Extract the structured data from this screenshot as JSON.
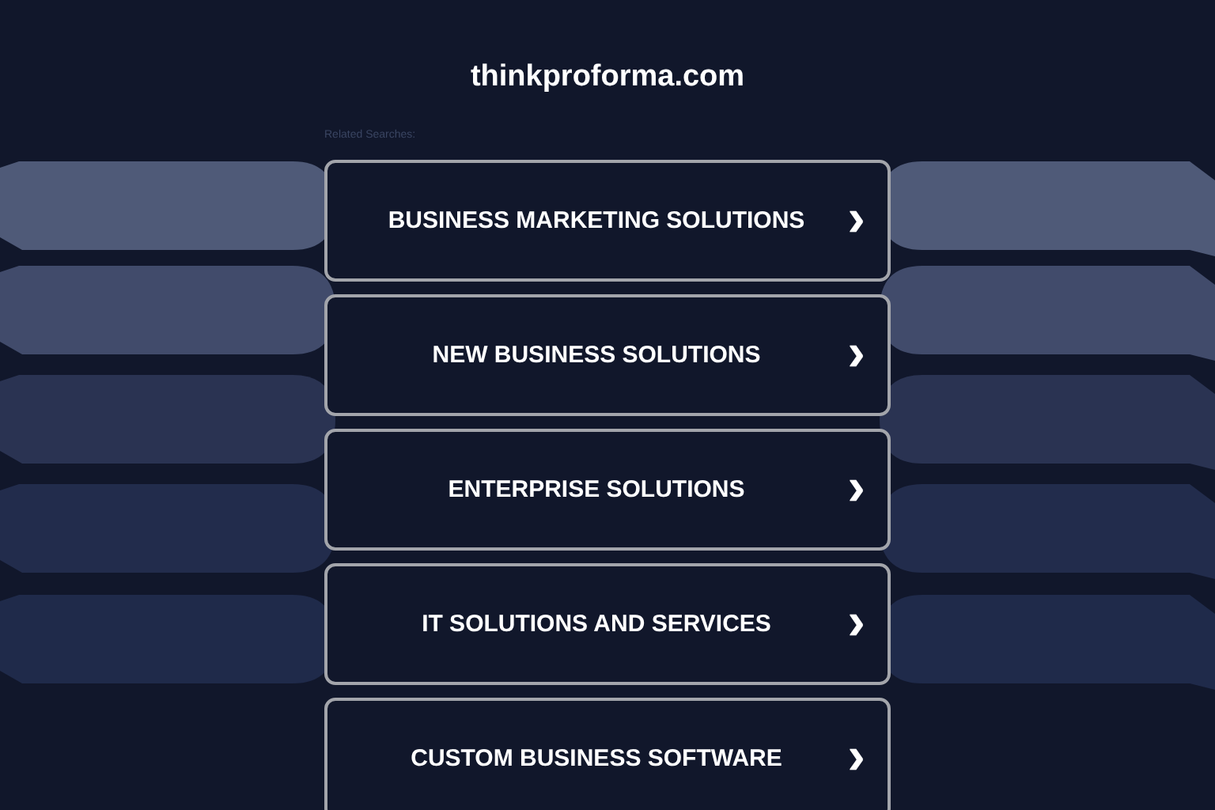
{
  "header": {
    "title": "thinkproforma.com"
  },
  "related_searches": {
    "label": "Related Searches:",
    "links": [
      {
        "text": "BUSINESS MARKETING SOLUTIONS",
        "icon": "›"
      },
      {
        "text": "NEW BUSINESS SOLUTIONS",
        "icon": "›"
      },
      {
        "text": "ENTERPRISE SOLUTIONS",
        "icon": "›"
      },
      {
        "text": "IT SOLUTIONS AND SERVICES",
        "icon": "›"
      },
      {
        "text": "CUSTOM BUSINESS SOFTWARE",
        "icon": "›"
      }
    ]
  }
}
